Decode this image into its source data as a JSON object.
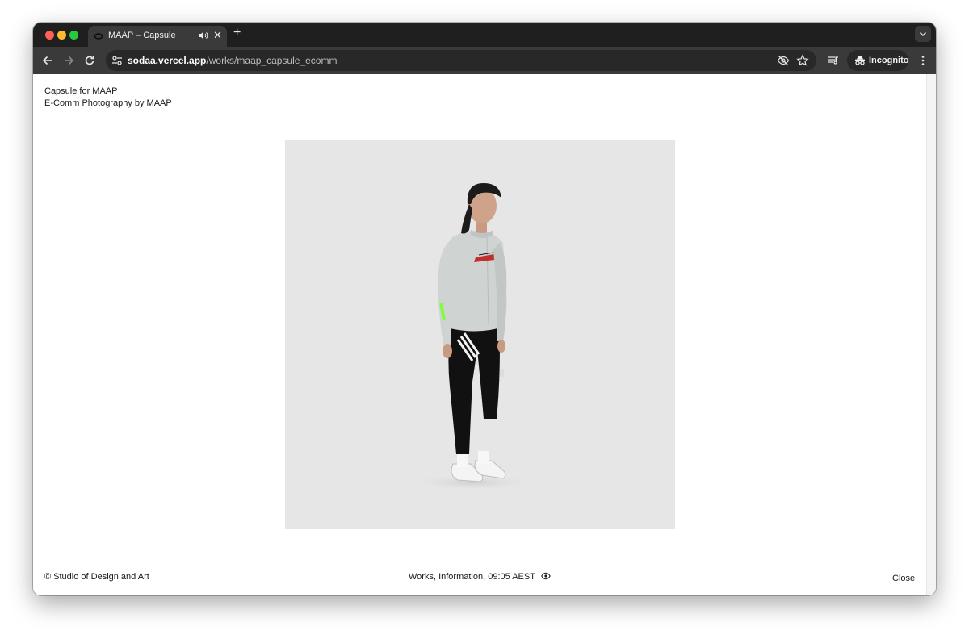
{
  "browser": {
    "tab_title": "MAAP – Capsule",
    "new_tab_glyph": "+",
    "close_glyph": "✕",
    "url_host": "sodaa.vercel.app",
    "url_path": "/works/maap_capsule_ecomm",
    "incognito_label": "Incognito"
  },
  "page": {
    "title": "Capsule for MAAP",
    "subtitle": "E-Comm Photography by MAAP",
    "hero_image": "cyclist-model-long-sleeve-jersey-bib-tights",
    "footer": {
      "copyright": "© Studio of Design and Art",
      "nav": "Works, Information, 09:05 AEST",
      "close": "Close"
    }
  },
  "colors": {
    "tab_strip": "#1f1f1f",
    "toolbar": "#3a3a3a",
    "hero_background": "#e6e6e6",
    "jersey": "#cfd3d1",
    "accent_green": "#7dff3a",
    "logo_red": "#c0312b"
  },
  "icons": [
    "back-icon",
    "forward-icon",
    "reload-icon",
    "site-info-icon",
    "eye-off-icon",
    "star-icon",
    "media-icon",
    "incognito-icon",
    "more-icon",
    "audio-icon",
    "eye-icon"
  ]
}
